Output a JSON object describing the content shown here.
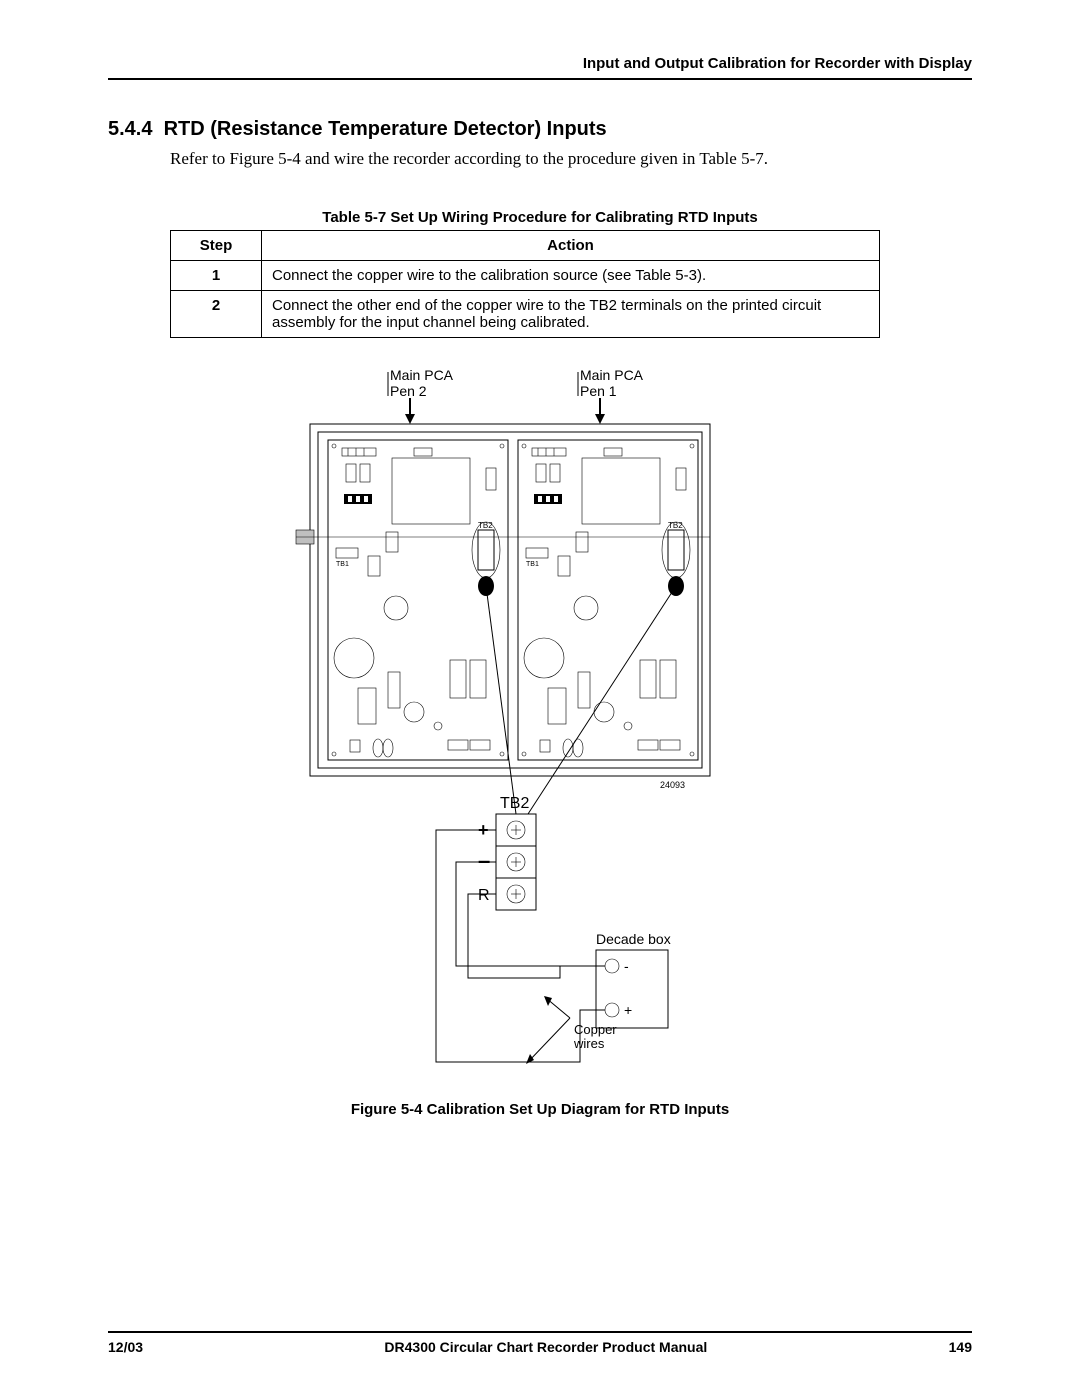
{
  "running_head": "Input and Output Calibration for Recorder with Display",
  "section": {
    "number": "5.4.4",
    "title": "RTD (Resistance Temperature Detector) Inputs",
    "intro": "Refer to Figure 5-4 and wire the recorder according to the procedure given in Table 5-7."
  },
  "table": {
    "caption": "Table 5-7  Set Up Wiring Procedure for Calibrating RTD Inputs",
    "headers": {
      "step": "Step",
      "action": "Action"
    },
    "rows": [
      {
        "step": "1",
        "action": "Connect the copper wire to the calibration source (see Table 5-3)."
      },
      {
        "step": "2",
        "action": "Connect the other end of the copper wire to the TB2 terminals on the printed circuit assembly for the input channel being calibrated."
      }
    ]
  },
  "figure": {
    "caption": "Figure 5-4  Calibration Set Up Diagram for RTD Inputs",
    "labels": {
      "pca_left": "Main PCA\nPen 2",
      "pca_right": "Main PCA\nPen 1",
      "tb2_small": "TB2",
      "tb1_small": "TB1",
      "tb2_title": "TB2",
      "plus": "+",
      "minus": "−",
      "r": "R",
      "decade_box": "Decade box",
      "box_minus": "-",
      "box_plus": "+",
      "copper_wires": "Copper\nwires",
      "drawing_no": "24093"
    }
  },
  "footer": {
    "date": "12/03",
    "title": "DR4300 Circular Chart Recorder Product Manual",
    "page": "149"
  }
}
